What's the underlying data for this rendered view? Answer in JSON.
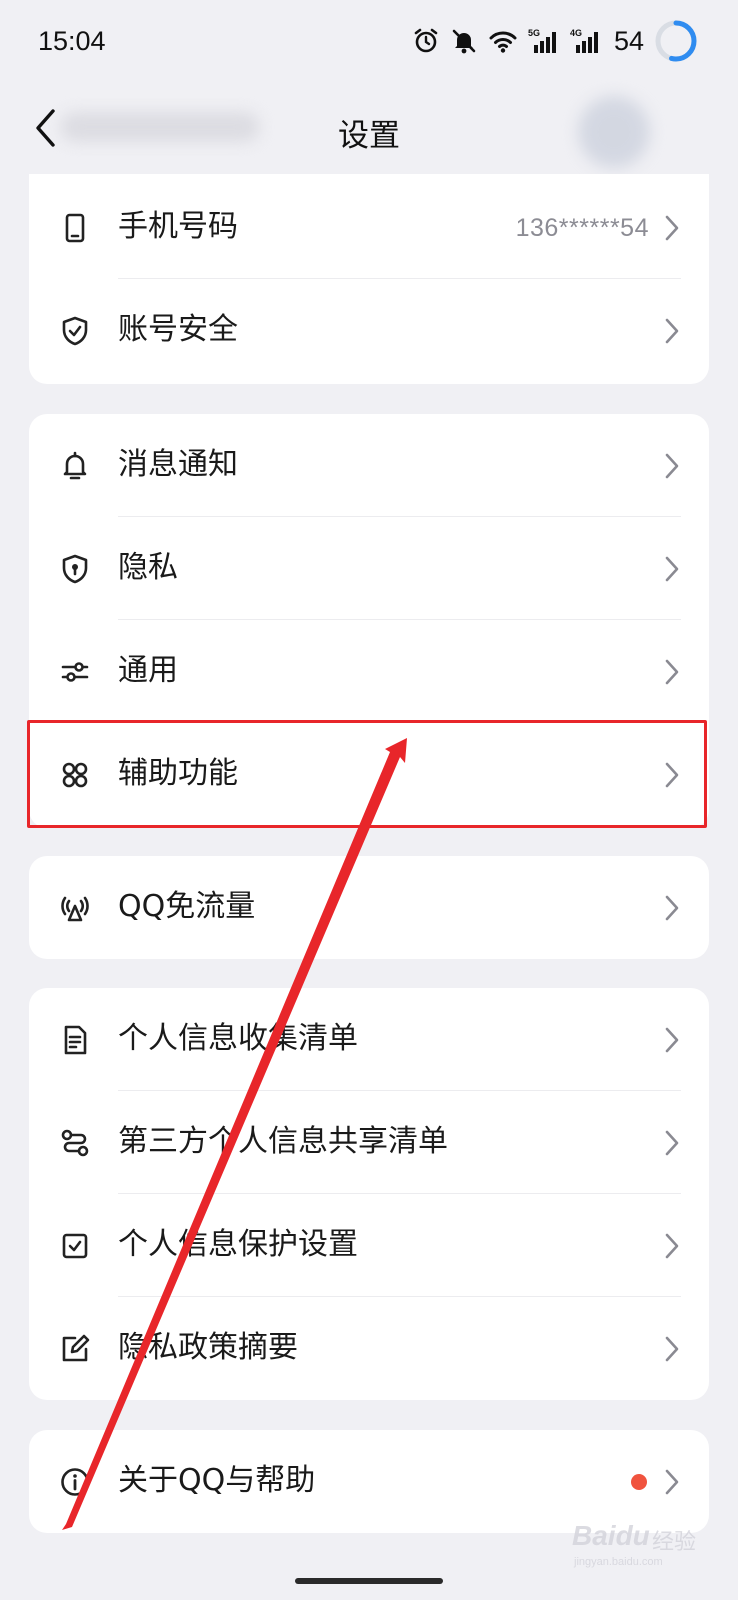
{
  "status_bar": {
    "time": "15:04",
    "battery": "54",
    "icons": [
      "alarm-icon",
      "mute-icon",
      "wifi-icon",
      "signal-5g-icon",
      "signal-4g-icon",
      "battery-ring-icon"
    ],
    "network_labels": [
      "5G",
      "4G"
    ]
  },
  "nav": {
    "title": "设置"
  },
  "groups": [
    {
      "items": [
        {
          "icon": "phone-icon",
          "label": "手机号码",
          "value": "136******54"
        },
        {
          "icon": "shield-check-icon",
          "label": "账号安全"
        }
      ]
    },
    {
      "items": [
        {
          "icon": "bell-icon",
          "label": "消息通知"
        },
        {
          "icon": "privacy-shield-icon",
          "label": "隐私"
        },
        {
          "icon": "sliders-icon",
          "label": "通用"
        },
        {
          "icon": "accessibility-icon",
          "label": "辅助功能"
        }
      ]
    },
    {
      "items": [
        {
          "icon": "free-data-icon",
          "label": "QQ免流量"
        }
      ]
    },
    {
      "items": [
        {
          "icon": "document-icon",
          "label": "个人信息收集清单"
        },
        {
          "icon": "share-flow-icon",
          "label": "第三方个人信息共享清单"
        },
        {
          "icon": "checkbox-icon",
          "label": "个人信息保护设置"
        },
        {
          "icon": "edit-icon",
          "label": "隐私政策摘要"
        }
      ]
    },
    {
      "items": [
        {
          "icon": "info-icon",
          "label": "关于QQ与帮助",
          "badge": "red-dot"
        }
      ]
    }
  ],
  "annotation": {
    "highlight_color": "#e8262a",
    "highlighted_item": "辅助功能"
  },
  "watermark": {
    "logo": "Baidu",
    "text": "经验",
    "url": "jingyan.baidu.com"
  },
  "colors": {
    "background": "#f0f0f4",
    "card": "#ffffff",
    "secondary_text": "#8c8c94",
    "badge": "#f0533e",
    "battery_ring": "#2f8cf0"
  }
}
